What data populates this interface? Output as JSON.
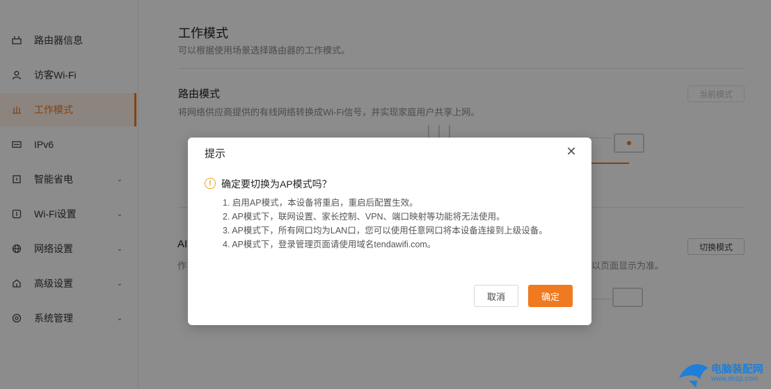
{
  "sidebar": {
    "items": [
      {
        "label": "路由器信息",
        "icon": "router-info-icon",
        "expandable": false,
        "active": false
      },
      {
        "label": "访客Wi-Fi",
        "icon": "guest-user-icon",
        "expandable": false,
        "active": false
      },
      {
        "label": "工作模式",
        "icon": "work-mode-icon",
        "expandable": false,
        "active": true
      },
      {
        "label": "IPv6",
        "icon": "ipv6-icon",
        "expandable": false,
        "active": false
      },
      {
        "label": "智能省电",
        "icon": "power-save-icon",
        "expandable": true,
        "active": false
      },
      {
        "label": "Wi-Fi设置",
        "icon": "wifi-settings-icon",
        "expandable": true,
        "active": false
      },
      {
        "label": "网络设置",
        "icon": "network-settings-icon",
        "expandable": true,
        "active": false
      },
      {
        "label": "高级设置",
        "icon": "advanced-settings-icon",
        "expandable": true,
        "active": false
      },
      {
        "label": "系统管理",
        "icon": "system-manage-icon",
        "expandable": true,
        "active": false
      }
    ]
  },
  "main": {
    "title": "工作模式",
    "subtitle": "可以根据使用场景选择路由器的工作模式。",
    "router_mode": {
      "title": "路由模式",
      "desc": "将网络供应商提供的有线网络转换成Wi-Fi信号，并实现家庭用户共享上网。",
      "button": "当前模式"
    },
    "ap_mode": {
      "title_fragment": "AI",
      "desc_fragment": "作",
      "desc_tail": "以页面显示为准。",
      "button": "切换模式"
    }
  },
  "dialog": {
    "title": "提示",
    "question": "确定要切换为AP模式吗？",
    "items": [
      "1. 启用AP模式，本设备将重启，重启后配置生效。",
      "2. AP模式下，联网设置、家长控制、VPN、端口映射等功能将无法使用。",
      "3. AP模式下，所有网口均为LAN口，您可以使用任意网口将本设备连接到上级设备。",
      "4. AP模式下，登录管理页面请使用域名tendawifi.com。"
    ],
    "cancel": "取消",
    "confirm": "确定"
  },
  "watermark": {
    "line1": "电脑装配网",
    "line2": "www.dnzp.com"
  },
  "colors": {
    "accent": "#f07a1f",
    "warning": "#f0a020"
  }
}
